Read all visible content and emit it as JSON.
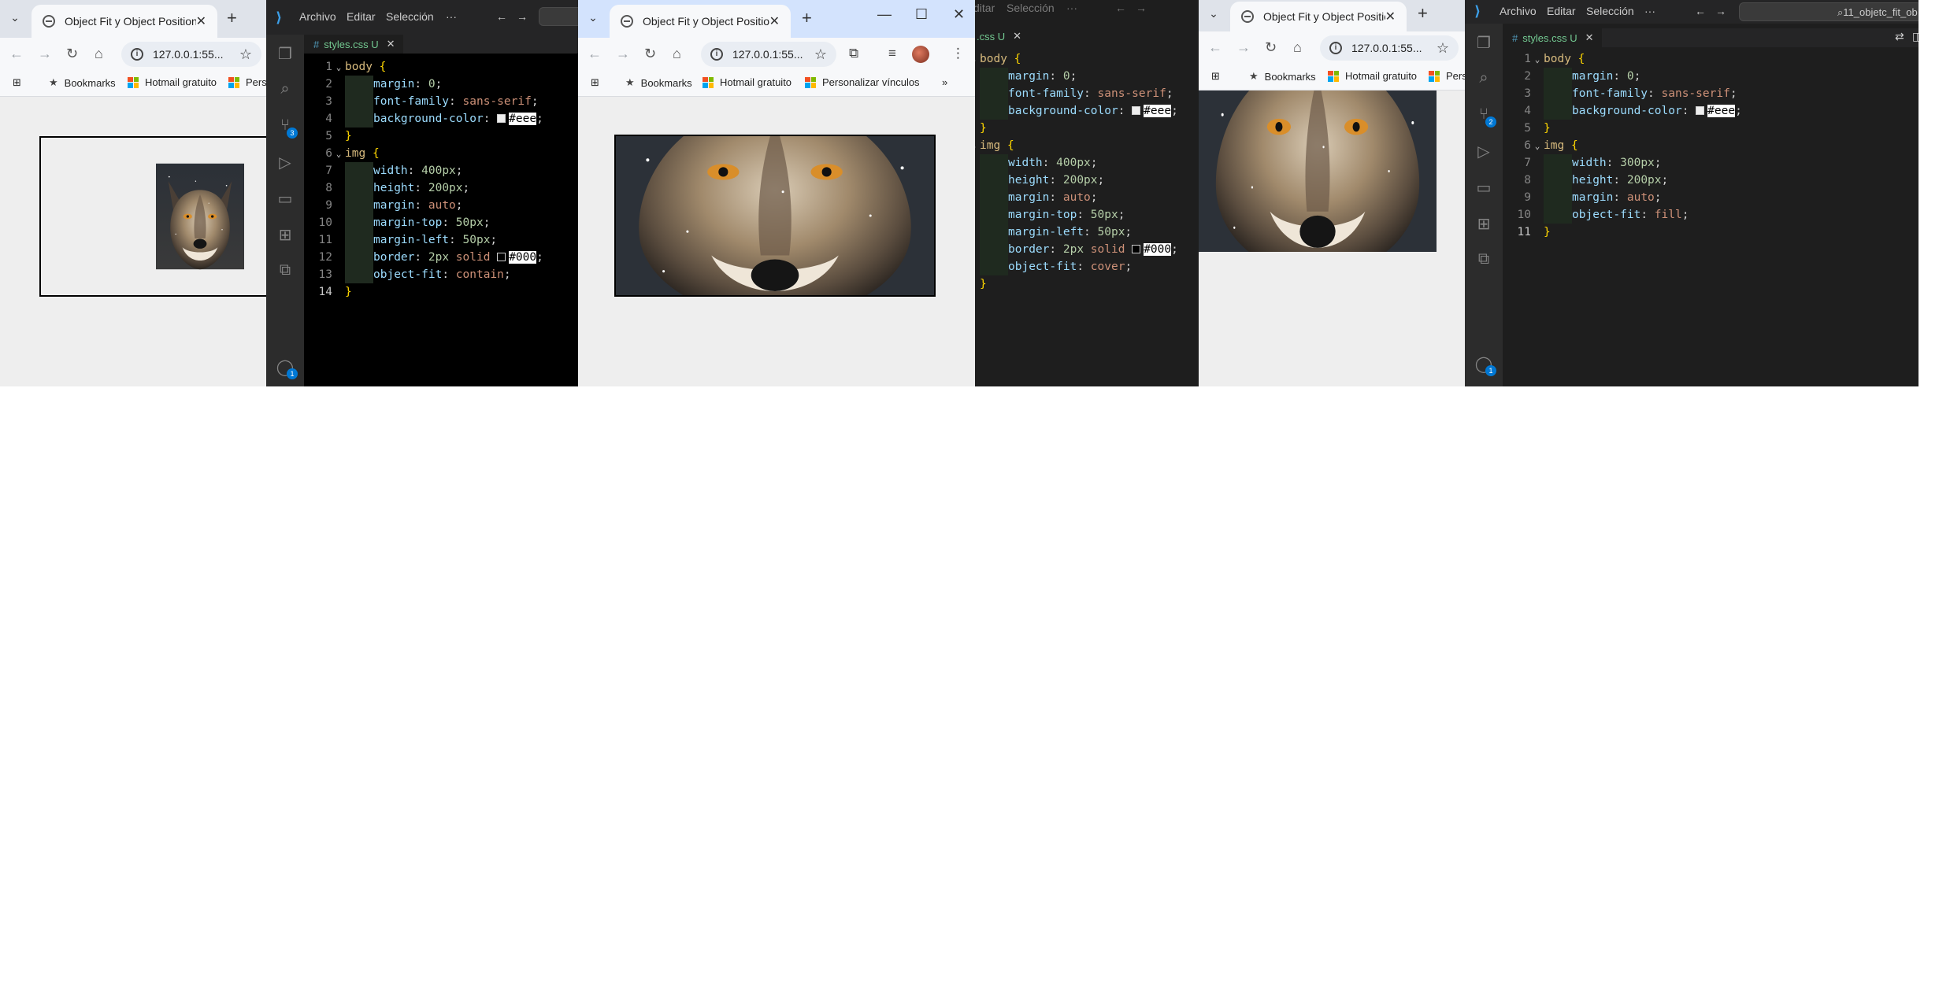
{
  "browser_tab_title": "Object Fit y Object Position",
  "browser_url": "127.0.0.1:55...",
  "bookmarks": {
    "b1": "Bookmarks",
    "b2": "Hotmail gratuito",
    "b3": "Personalizar vínculos",
    "b3_truncated": "Perso",
    "b3_truncated2": "Pers"
  },
  "vscode": {
    "menu_file": "Archivo",
    "menu_edit": "Editar",
    "menu_selection": "Selección",
    "menu_more": "···",
    "menu_edit_partial": "ditar",
    "file_tab": "styles.css",
    "file_tab_partial": ".css",
    "file_status": "U",
    "search_text": "11_objetc_fit_ob"
  },
  "code_contain": [
    "body {",
    "margin: 0;",
    "font-family: sans-serif;",
    "background-color: #eee;",
    "}",
    "img {",
    "width: 400px;",
    "height: 200px;",
    "margin: auto;",
    "margin-top: 50px;",
    "margin-left: 50px;",
    "border: 2px solid #000;",
    "object-fit: contain;",
    "}"
  ],
  "code_cover": [
    "body {",
    "margin: 0;",
    "font-family: sans-serif;",
    "background-color: #eee;",
    "}",
    "img {",
    "width: 400px;",
    "height: 200px;",
    "margin: auto;",
    "margin-top: 50px;",
    "margin-left: 50px;",
    "border: 2px solid #000;",
    "object-fit: cover;",
    "}"
  ],
  "code_fill": [
    "body {",
    "margin: 0;",
    "font-family: sans-serif;",
    "background-color: #eee;",
    "}",
    "img {",
    "width: 300px;",
    "height: 200px;",
    "margin: auto;",
    "object-fit: fill;",
    "}"
  ],
  "icons": [
    "chevron-down-icon",
    "globe-icon",
    "close-icon",
    "plus-icon",
    "back-icon",
    "forward-icon",
    "reload-icon",
    "home-icon",
    "info-icon",
    "star-icon",
    "apps-icon",
    "extensions-icon",
    "media-icon",
    "avatar-icon",
    "menu-icon",
    "vscode-logo-icon",
    "explorer-icon",
    "search-icon",
    "source-control-icon",
    "run-icon",
    "remote-icon",
    "extensions-icon",
    "accounts-icon"
  ],
  "colors": {
    "page_bg": "#eeeeee",
    "tab_active": "#d3e3fd",
    "vscode_bg": "#1e1e1e",
    "badge": "#0078d4"
  }
}
